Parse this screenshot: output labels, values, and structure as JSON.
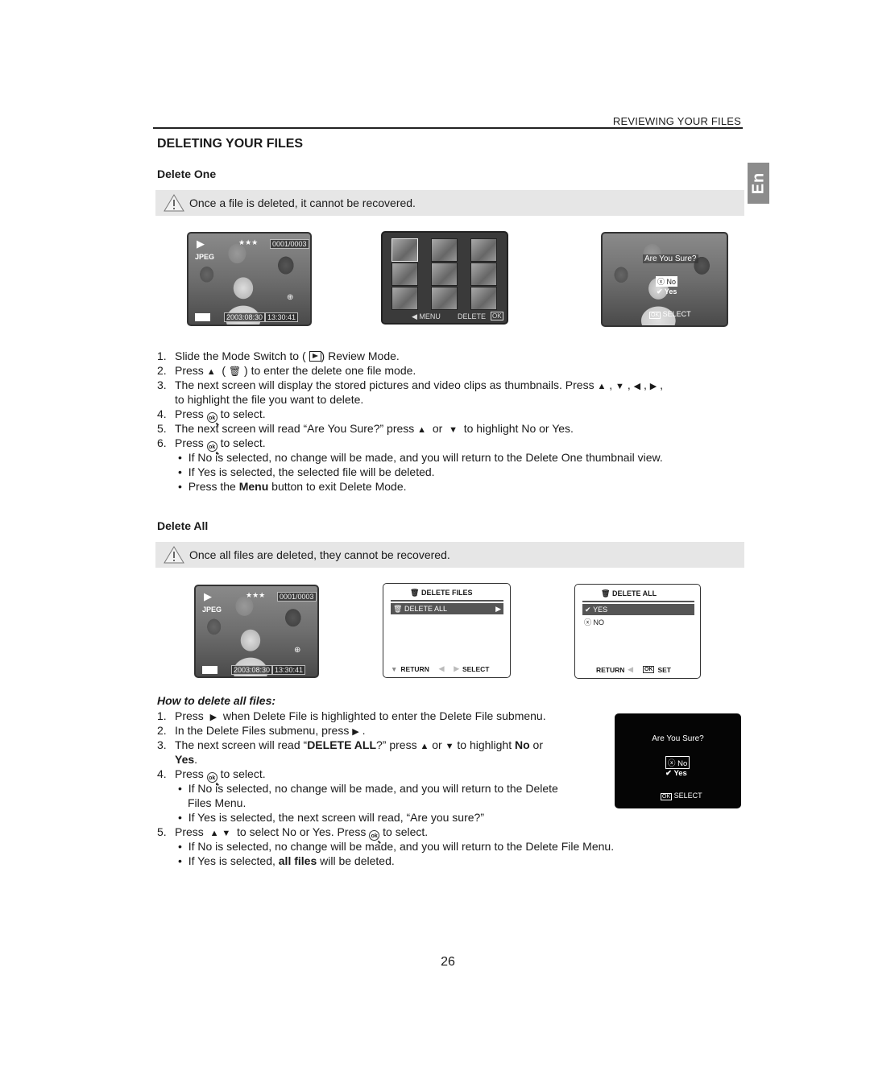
{
  "running_head": "REVIEWING YOUR FILES",
  "section_title": "DELETING YOUR FILES",
  "language_tab": "En",
  "page_number": "26",
  "delete_one": {
    "title": "Delete One",
    "warning": "Once a file is deleted, it cannot be recovered.",
    "screens": {
      "review": {
        "format": "JPEG",
        "counter": "0001/0003",
        "stars": "★★★",
        "date": "2003:08:30",
        "time": "13:30:41"
      },
      "thumbnails": {
        "count": 9,
        "menu_label": "MENU",
        "delete_label": "DELETE",
        "ok_label": "OK"
      },
      "confirm": {
        "question": "Are You Sure?",
        "no": "No",
        "yes": "Yes",
        "select": "SELECT",
        "ok_label": "OK"
      }
    },
    "steps": [
      {
        "n": "1.",
        "pre": "Slide the Mode Switch to (",
        "post": ") Review Mode."
      },
      {
        "n": "2.",
        "pre": "Press",
        "mid1": "(",
        "post": ") to enter the delete one file mode."
      },
      {
        "n": "3.",
        "pre": "The next screen will display the stored pictures and video clips as thumbnails. Press",
        "post": ",",
        "cont": "to highlight the file you want to delete."
      },
      {
        "n": "4.",
        "pre": "Press",
        "post": "to select."
      },
      {
        "n": "5.",
        "pre": "The next screen will read “Are You Sure?” press",
        "mid1": "or",
        "post": "to highlight No or Yes."
      },
      {
        "n": "6.",
        "pre": "Press",
        "post": "to select."
      }
    ],
    "bullets": [
      "If No is selected, no change will be made, and you will return to the Delete One thumbnail view.",
      "If Yes is selected, the selected file will be deleted."
    ],
    "bullet_menu": {
      "pre": "Press the",
      "bold": "Menu",
      "post": "button to exit Delete Mode."
    }
  },
  "delete_all": {
    "title": "Delete All",
    "warning": "Once all files are deleted, they cannot be recovered.",
    "screens": {
      "review": {
        "format": "JPEG",
        "counter": "0001/0003",
        "stars": "★★★",
        "date": "2003:08:30",
        "time": "13:30:41"
      },
      "delete_files_menu": {
        "title": "DELETE FILES",
        "item": "DELETE ALL",
        "return_label": "RETURN",
        "select_label": "SELECT"
      },
      "delete_all_menu": {
        "title": "DELETE ALL",
        "yes": "YES",
        "no": "NO",
        "return_label": "RETURN",
        "set_label": "SET",
        "ok_label": "OK"
      },
      "confirm": {
        "question": "Are You Sure?",
        "no": "No",
        "yes": "Yes",
        "select": "SELECT",
        "ok_label": "OK"
      }
    },
    "howto_title": "How to delete all files:",
    "steps": {
      "s1": {
        "n": "1.",
        "pre": "Press",
        "post": "when Delete File is highlighted to enter the Delete File submenu."
      },
      "s2": {
        "n": "2.",
        "pre": "In the Delete Files submenu, press",
        "post": "."
      },
      "s3": {
        "n": "3.",
        "pre": "The next screen will read “",
        "bold1": "DELETE ALL",
        "mid": "?” press",
        "or": "or",
        "post": "to highlight",
        "bold2": "No",
        "post2": "or",
        "bold3": "Yes",
        "end": "."
      },
      "s4": {
        "n": "4.",
        "pre": "Press",
        "post": "to select."
      },
      "s4_bullets": [
        "If No is selected, no change will be made, and you will return to the Delete",
        "Files Menu.",
        "If Yes is selected, the next screen will read, “Are you sure?”"
      ],
      "s5": {
        "n": "5.",
        "pre": "Press",
        "mid": "to select No or Yes. Press",
        "post": "to select."
      },
      "s5_bullets": [
        "If No is selected, no change will be made, and you will return to the Delete File Menu."
      ],
      "s5_last": {
        "pre": "If Yes is selected,",
        "bold": "all files",
        "post": "will be deleted."
      }
    }
  }
}
